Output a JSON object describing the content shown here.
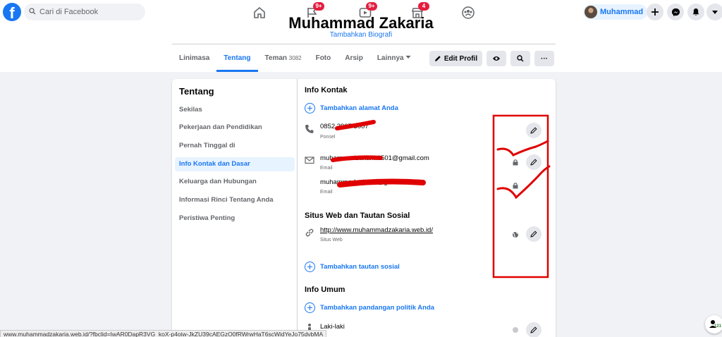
{
  "topbar": {
    "logo": "f",
    "search_placeholder": "Cari di Facebook",
    "nav": [
      {
        "icon": "home-icon",
        "badge": ""
      },
      {
        "icon": "flag-icon",
        "badge": "9+"
      },
      {
        "icon": "video-icon",
        "badge": "9+"
      },
      {
        "icon": "marketplace-icon",
        "badge": "4"
      },
      {
        "icon": "groups-icon",
        "badge": ""
      }
    ],
    "profile_name": "Muhammad"
  },
  "profile": {
    "name": "Muhammad Zakaria",
    "add_bio": "Tambahkan Biografi",
    "tabs": [
      {
        "label": "Linimasa",
        "count": ""
      },
      {
        "label": "Tentang",
        "count": ""
      },
      {
        "label": "Teman",
        "count": "3082"
      },
      {
        "label": "Foto",
        "count": ""
      },
      {
        "label": "Arsip",
        "count": ""
      },
      {
        "label": "Lainnya",
        "count": ""
      }
    ],
    "edit_profile": "Edit Profil",
    "more": "···"
  },
  "about": {
    "title": "Tentang",
    "menu": [
      "Sekilas",
      "Pekerjaan dan Pendidikan",
      "Pernah Tinggal di",
      "Info Kontak dan Dasar",
      "Keluarga dan Hubungan",
      "Informasi Rinci Tentang Anda",
      "Peristiwa Penting"
    ],
    "active_index": 3,
    "contact_title": "Info Kontak",
    "add_address": "Tambahkan alamat Anda",
    "phone_value": "0852 3907 3007",
    "phone_label": "Ponsel",
    "email1_value": "muhammadzakaria0501@gmail.com",
    "email1_label": "Email",
    "email2_value": "muhammadzakaria@gmail.com",
    "email2_label": "Email",
    "web_title": "Situs Web dan Tautan Sosial",
    "website_value": "http://www.muhammadzakaria.web.id/",
    "website_label": "Situs Web",
    "add_social": "Tambahkan tautan sosial",
    "general_title": "Info Umum",
    "add_politics": "Tambahkan pandangan politik Anda",
    "gender_value": "Laki-laki"
  },
  "status_bar_url": "www.muhammadzakaria.web.id/?fbclid=IwAR0DapR3VG_koX-p4oiw-JkZU39cAEGzO0fRWrwHaT6scWidYeJo75dvbMA",
  "chat_count": "121",
  "colors": {
    "brand": "#1877f2",
    "annotation": "#e00000"
  }
}
